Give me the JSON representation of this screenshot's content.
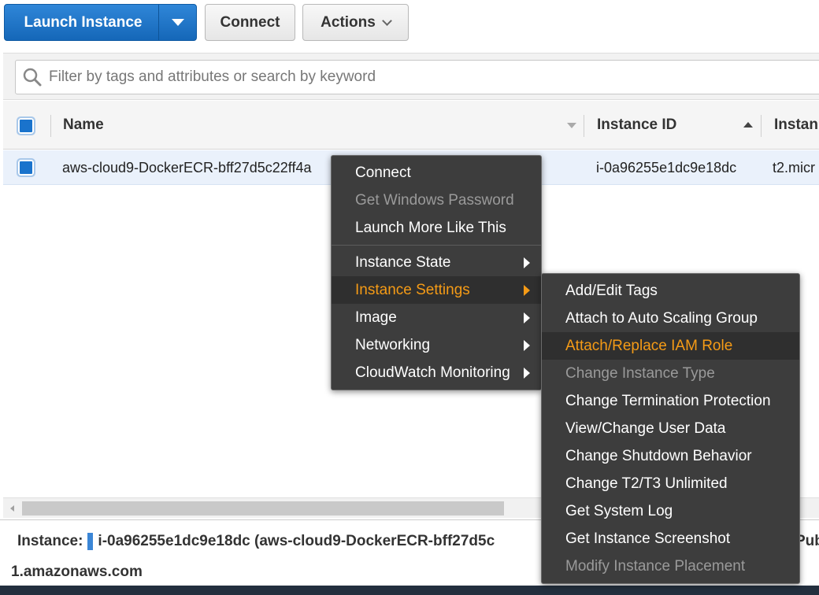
{
  "toolbar": {
    "launch_label": "Launch Instance",
    "connect_label": "Connect",
    "actions_label": "Actions"
  },
  "search": {
    "placeholder": "Filter by tags and attributes or search by keyword"
  },
  "table": {
    "columns": [
      "Name",
      "Instance ID",
      "Instan"
    ],
    "rows": [
      {
        "name": "aws-cloud9-DockerECR-bff27d5c22ff4a",
        "instance_id": "i-0a96255e1dc9e18dc",
        "type": "t2.micr"
      }
    ]
  },
  "context_menu": {
    "items": [
      {
        "label": "Connect"
      },
      {
        "label": "Get Windows Password"
      },
      {
        "label": "Launch More Like This"
      },
      {
        "label": "Instance State"
      },
      {
        "label": "Instance Settings"
      },
      {
        "label": "Image"
      },
      {
        "label": "Networking"
      },
      {
        "label": "CloudWatch Monitoring"
      }
    ]
  },
  "submenu": {
    "items": [
      {
        "label": "Add/Edit Tags"
      },
      {
        "label": "Attach to Auto Scaling Group"
      },
      {
        "label": "Attach/Replace IAM Role"
      },
      {
        "label": "Change Instance Type"
      },
      {
        "label": "Change Termination Protection"
      },
      {
        "label": "View/Change User Data"
      },
      {
        "label": "Change Shutdown Behavior"
      },
      {
        "label": "Change T2/T3 Unlimited"
      },
      {
        "label": "Get System Log"
      },
      {
        "label": "Get Instance Screenshot"
      },
      {
        "label": "Modify Instance Placement"
      }
    ]
  },
  "details": {
    "prefix": "Instance:",
    "summary": "i-0a96255e1dc9e18dc (aws-cloud9-DockerECR-bff27d5c",
    "public_label_fragment": "Pub",
    "line2": "1.amazonaws.com"
  },
  "colors": {
    "primary": "#1a6fc4",
    "menu_bg": "#3d3d3d",
    "menu_highlight": "#f59b16",
    "row_selected": "#eaf1fb"
  }
}
